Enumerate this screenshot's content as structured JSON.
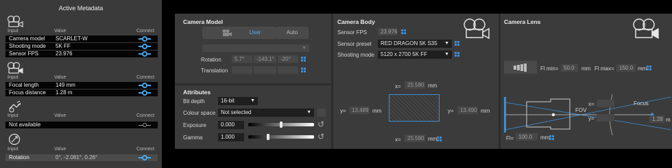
{
  "metadata": {
    "title": "Active Metadata",
    "columns": {
      "input": "Input",
      "value": "Value",
      "connect": "Connect"
    },
    "camera_rows": [
      {
        "key": "Camera model",
        "value": "SCARLET-W"
      },
      {
        "key": "Shooting mode",
        "value": "5K FF"
      },
      {
        "key": "Sensor FPS",
        "value": "23.976"
      }
    ],
    "lens_rows": [
      {
        "key": "Focal length",
        "value": "149 mm"
      },
      {
        "key": "Focus distance",
        "value": "1.28 m"
      }
    ],
    "tracker_rows": [
      {
        "key": "Not available",
        "value": ""
      }
    ],
    "rotation_row": {
      "key": "Rotation",
      "value": "0°, -2.081°, 0.26°"
    }
  },
  "camera_model": {
    "title": "Camera Model",
    "user_label": "User",
    "auto_label": "Auto",
    "rotation_label": "Rotation",
    "rotation": [
      "5.7°",
      "-143.1°",
      "-20°"
    ],
    "translation_label": "Translation"
  },
  "attributes": {
    "title": "Attributes",
    "bit_depth_label": "Bit depth",
    "bit_depth": "16-bit",
    "colour_space_label": "Colour space",
    "colour_space": "Not selected",
    "exposure_label": "Exposure",
    "exposure": "0.000",
    "gamma_label": "Gamma",
    "gamma": "1.000"
  },
  "camera_body": {
    "title": "Camera Body",
    "sensor_fps_label": "Sensor FPS",
    "sensor_fps": "23.976",
    "sensor_preset_label": "Sensor preset",
    "sensor_preset": "RED DRAGON 5K S35",
    "shooting_mode_label": "Shooting mode",
    "shooting_mode": "5120 x 2700 5K FF",
    "x_label": "x=",
    "y_label": "y=",
    "top_width": "25.580",
    "bottom_width": "25.580",
    "left_height": "13.489",
    "right_height": "13.490",
    "unit": "mm"
  },
  "camera_lens": {
    "title": "Camera Lens",
    "fl_min_label": "Fl min=",
    "fl_min": "50.0",
    "fl_max_label": "Fl max=",
    "fl_max": "150.0",
    "fl_label": "Fl=",
    "fl": "100.0",
    "fov_label": "FOV",
    "x_label": "x=",
    "y_label": "y=",
    "focus_label": "Focus",
    "focus": "1.28",
    "focus_unit": "m",
    "unit": "mm"
  },
  "colors": {
    "accent": "#4aa6e8",
    "panel": "#3b3b3b",
    "field": "#474747"
  }
}
